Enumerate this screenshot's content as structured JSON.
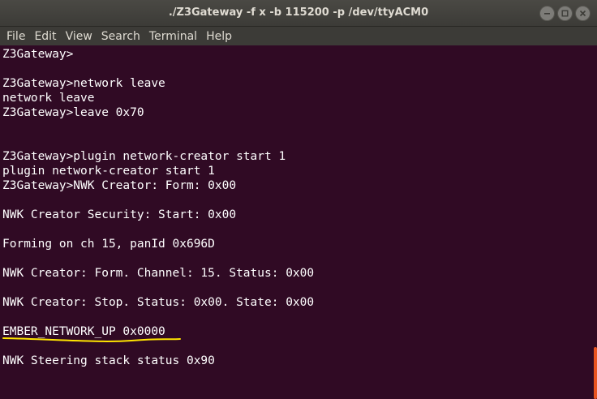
{
  "window": {
    "title": "./Z3Gateway -f x -b 115200 -p /dev/ttyACM0"
  },
  "menu": {
    "items": [
      "File",
      "Edit",
      "View",
      "Search",
      "Terminal",
      "Help"
    ]
  },
  "terminal": {
    "lines": [
      "Z3Gateway>",
      "",
      "Z3Gateway>network leave",
      "network leave",
      "Z3Gateway>leave 0x70",
      "",
      "",
      "Z3Gateway>plugin network-creator start 1",
      "plugin network-creator start 1",
      "Z3Gateway>NWK Creator: Form: 0x00",
      "",
      "NWK Creator Security: Start: 0x00",
      "",
      "Forming on ch 15, panId 0x696D",
      "",
      "NWK Creator: Form. Channel: 15. Status: 0x00",
      "",
      "NWK Creator: Stop. Status: 0x00. State: 0x00",
      "",
      "EMBER_NETWORK_UP 0x0000",
      "",
      "NWK Steering stack status 0x90"
    ]
  },
  "colors": {
    "background": "#300a24",
    "text": "#ffffff",
    "highlight": "#ffe600",
    "scroll_thumb": "#e95420"
  }
}
